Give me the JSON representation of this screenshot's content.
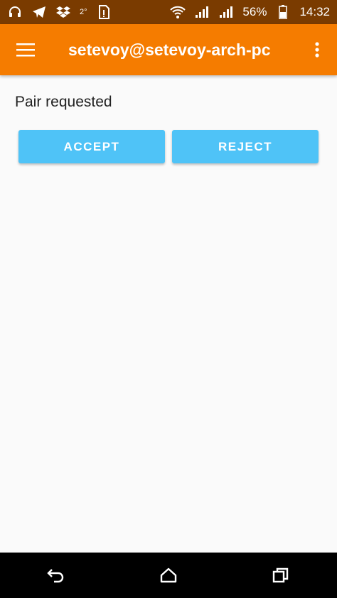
{
  "status_bar": {
    "icons_left": [
      "headset-icon",
      "telegram-icon",
      "dropbox-icon",
      "temperature-icon",
      "sim-alert-icon"
    ],
    "temperature": "2°",
    "icons_right": [
      "wifi-icon",
      "signal-icon",
      "signal-icon",
      "battery-icon"
    ],
    "battery": "56%",
    "time": "14:32"
  },
  "app_bar": {
    "title": "setevoy@setevoy-arch-pc",
    "menu_icon": "hamburger-menu-icon",
    "overflow_icon": "more-vert-icon",
    "color": "#f57c00"
  },
  "content": {
    "message": "Pair requested",
    "accept_label": "ACCEPT",
    "reject_label": "REJECT",
    "button_color": "#4fc3f7"
  },
  "nav_bar": {
    "icons": [
      "back-icon",
      "home-icon",
      "recents-icon"
    ]
  }
}
